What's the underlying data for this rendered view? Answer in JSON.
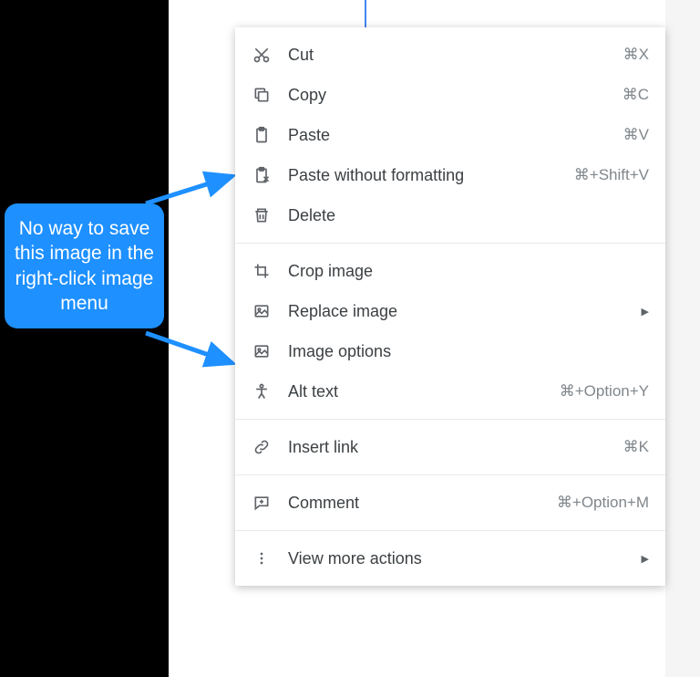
{
  "callout": {
    "text": "No way to save this image in the right-click image menu"
  },
  "menu": {
    "cut": {
      "label": "Cut",
      "shortcut": "⌘X"
    },
    "copy": {
      "label": "Copy",
      "shortcut": "⌘C"
    },
    "paste": {
      "label": "Paste",
      "shortcut": "⌘V"
    },
    "pastePlain": {
      "label": "Paste without formatting",
      "shortcut": "⌘+Shift+V"
    },
    "delete": {
      "label": "Delete",
      "shortcut": ""
    },
    "crop": {
      "label": "Crop image",
      "shortcut": ""
    },
    "replace": {
      "label": "Replace image",
      "shortcut": ""
    },
    "imgOptions": {
      "label": "Image options",
      "shortcut": ""
    },
    "altText": {
      "label": "Alt text",
      "shortcut": "⌘+Option+Y"
    },
    "insertLink": {
      "label": "Insert link",
      "shortcut": "⌘K"
    },
    "comment": {
      "label": "Comment",
      "shortcut": "⌘+Option+M"
    },
    "viewMore": {
      "label": "View more actions",
      "shortcut": ""
    }
  }
}
